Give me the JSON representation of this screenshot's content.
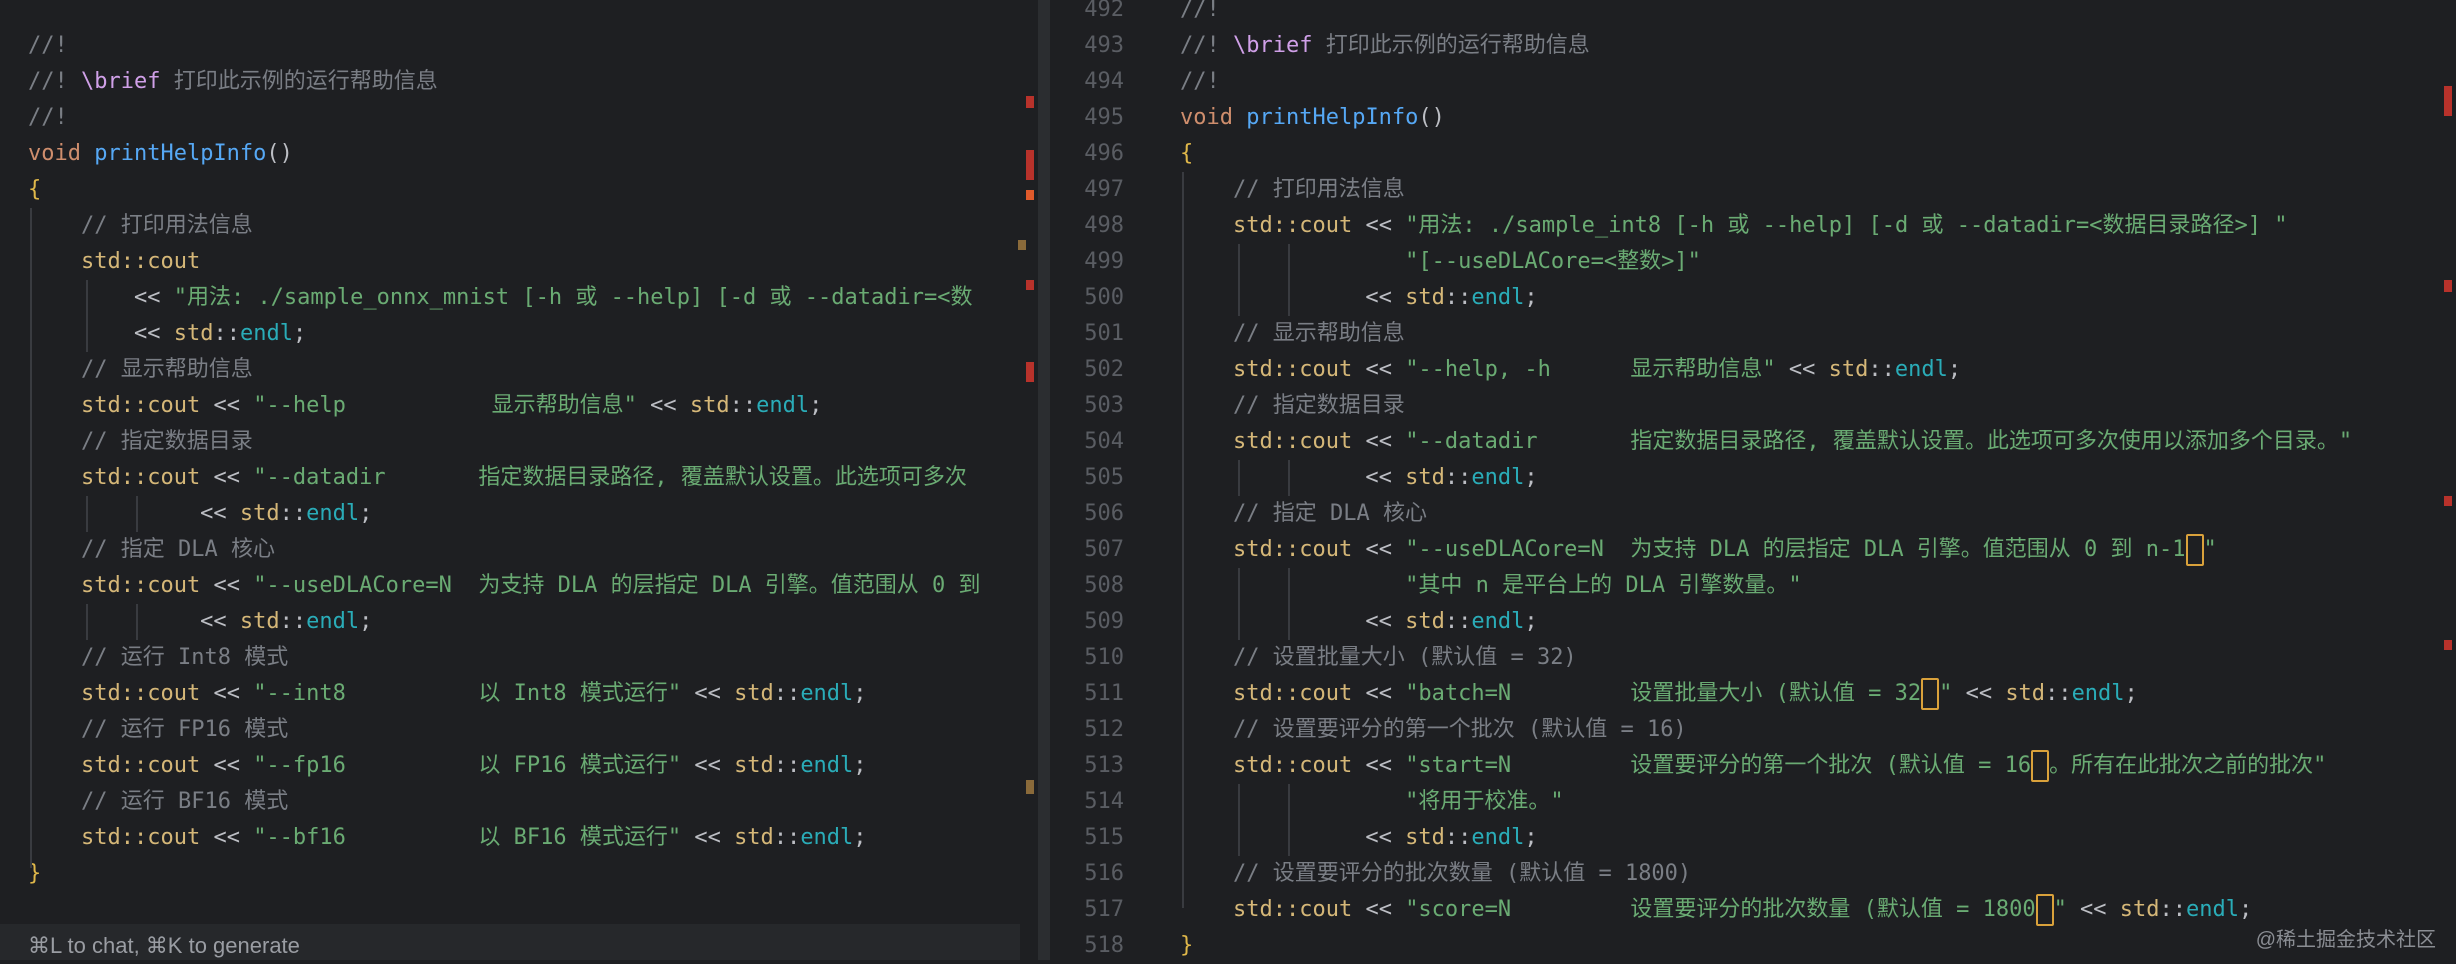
{
  "left": {
    "lines": [
      {
        "tokens": [
          [
            "c-comment",
            "//!"
          ]
        ]
      },
      {
        "tokens": [
          [
            "c-comment",
            "//! "
          ],
          [
            "c-doxy",
            "\\brief"
          ],
          [
            "c-comment",
            " 打印此示例的运行帮助信息"
          ]
        ]
      },
      {
        "tokens": [
          [
            "c-comment",
            "//!"
          ]
        ]
      },
      {
        "tokens": [
          [
            "c-keyword",
            "void"
          ],
          [
            "c-op",
            " "
          ],
          [
            "c-func",
            "printHelpInfo"
          ],
          [
            "c-op",
            "()"
          ]
        ]
      },
      {
        "tokens": [
          [
            "c-brace",
            "{"
          ]
        ]
      },
      {
        "tokens": [
          [
            "c-op",
            "    "
          ],
          [
            "c-comment",
            "// 打印用法信息"
          ]
        ]
      },
      {
        "tokens": [
          [
            "c-op",
            "    "
          ],
          [
            "c-ident",
            "std::cout"
          ]
        ]
      },
      {
        "tokens": [
          [
            "c-op",
            "        << "
          ],
          [
            "c-string",
            "\"用法: ./sample_onnx_mnist [-h 或 --help] [-d 或 --datadir=<数"
          ]
        ]
      },
      {
        "tokens": [
          [
            "c-op",
            "        << "
          ],
          [
            "c-ident",
            "std"
          ],
          [
            "c-colon",
            "::"
          ],
          [
            "c-endl",
            "endl"
          ],
          [
            "c-op",
            ";"
          ]
        ]
      },
      {
        "tokens": [
          [
            "c-op",
            "    "
          ],
          [
            "c-comment",
            "// 显示帮助信息"
          ]
        ]
      },
      {
        "tokens": [
          [
            "c-op",
            "    "
          ],
          [
            "c-ident",
            "std::cout"
          ],
          [
            "c-op",
            " << "
          ],
          [
            "c-string",
            "\"--help           显示帮助信息\""
          ],
          [
            "c-op",
            " << "
          ],
          [
            "c-ident",
            "std"
          ],
          [
            "c-colon",
            "::"
          ],
          [
            "c-endl",
            "endl"
          ],
          [
            "c-op",
            ";"
          ]
        ]
      },
      {
        "tokens": [
          [
            "c-op",
            "    "
          ],
          [
            "c-comment",
            "// 指定数据目录"
          ]
        ]
      },
      {
        "tokens": [
          [
            "c-op",
            "    "
          ],
          [
            "c-ident",
            "std::cout"
          ],
          [
            "c-op",
            " << "
          ],
          [
            "c-string",
            "\"--datadir       指定数据目录路径, 覆盖默认设置。此选项可多次"
          ]
        ]
      },
      {
        "tokens": [
          [
            "c-op",
            "             << "
          ],
          [
            "c-ident",
            "std"
          ],
          [
            "c-colon",
            "::"
          ],
          [
            "c-endl",
            "endl"
          ],
          [
            "c-op",
            ";"
          ]
        ]
      },
      {
        "tokens": [
          [
            "c-op",
            "    "
          ],
          [
            "c-comment",
            "// 指定 DLA 核心"
          ]
        ]
      },
      {
        "tokens": [
          [
            "c-op",
            "    "
          ],
          [
            "c-ident",
            "std::cout"
          ],
          [
            "c-op",
            " << "
          ],
          [
            "c-string",
            "\"--useDLACore=N  为支持 DLA 的层指定 DLA 引擎。值范围从 0 到"
          ]
        ]
      },
      {
        "tokens": [
          [
            "c-op",
            "             << "
          ],
          [
            "c-ident",
            "std"
          ],
          [
            "c-colon",
            "::"
          ],
          [
            "c-endl",
            "endl"
          ],
          [
            "c-op",
            ";"
          ]
        ]
      },
      {
        "tokens": [
          [
            "c-op",
            "    "
          ],
          [
            "c-comment",
            "// 运行 Int8 模式"
          ]
        ]
      },
      {
        "tokens": [
          [
            "c-op",
            "    "
          ],
          [
            "c-ident",
            "std::cout"
          ],
          [
            "c-op",
            " << "
          ],
          [
            "c-string",
            "\"--int8          以 Int8 模式运行\""
          ],
          [
            "c-op",
            " << "
          ],
          [
            "c-ident",
            "std"
          ],
          [
            "c-colon",
            "::"
          ],
          [
            "c-endl",
            "endl"
          ],
          [
            "c-op",
            ";"
          ]
        ]
      },
      {
        "tokens": [
          [
            "c-op",
            "    "
          ],
          [
            "c-comment",
            "// 运行 FP16 模式"
          ]
        ]
      },
      {
        "tokens": [
          [
            "c-op",
            "    "
          ],
          [
            "c-ident",
            "std::cout"
          ],
          [
            "c-op",
            " << "
          ],
          [
            "c-string",
            "\"--fp16          以 FP16 模式运行\""
          ],
          [
            "c-op",
            " << "
          ],
          [
            "c-ident",
            "std"
          ],
          [
            "c-colon",
            "::"
          ],
          [
            "c-endl",
            "endl"
          ],
          [
            "c-op",
            ";"
          ]
        ]
      },
      {
        "tokens": [
          [
            "c-op",
            "    "
          ],
          [
            "c-comment",
            "// 运行 BF16 模式"
          ]
        ]
      },
      {
        "tokens": [
          [
            "c-op",
            "    "
          ],
          [
            "c-ident",
            "std::cout"
          ],
          [
            "c-op",
            " << "
          ],
          [
            "c-string",
            "\"--bf16          以 BF16 模式运行\""
          ],
          [
            "c-op",
            " << "
          ],
          [
            "c-ident",
            "std"
          ],
          [
            "c-colon",
            "::"
          ],
          [
            "c-endl",
            "endl"
          ],
          [
            "c-op",
            ";"
          ]
        ]
      },
      {
        "tokens": [
          [
            "c-brace",
            "}"
          ]
        ]
      }
    ],
    "chat_hint": "⌘L to chat, ⌘K to generate"
  },
  "right": {
    "lines": [
      {
        "num": "492",
        "tokens": [
          [
            "c-comment",
            "//!"
          ]
        ]
      },
      {
        "num": "493",
        "tokens": [
          [
            "c-comment",
            "//! "
          ],
          [
            "c-doxy",
            "\\brief"
          ],
          [
            "c-comment",
            " 打印此示例的运行帮助信息"
          ]
        ]
      },
      {
        "num": "494",
        "tokens": [
          [
            "c-comment",
            "//!"
          ]
        ]
      },
      {
        "num": "495",
        "tokens": [
          [
            "c-keyword",
            "void"
          ],
          [
            "c-op",
            " "
          ],
          [
            "c-func",
            "printHelpInfo"
          ],
          [
            "c-op",
            "()"
          ]
        ]
      },
      {
        "num": "496",
        "tokens": [
          [
            "c-brace",
            "{"
          ]
        ]
      },
      {
        "num": "497",
        "tokens": [
          [
            "c-op",
            "    "
          ],
          [
            "c-comment",
            "// 打印用法信息"
          ]
        ]
      },
      {
        "num": "498",
        "tokens": [
          [
            "c-op",
            "    "
          ],
          [
            "c-ident",
            "std::cout"
          ],
          [
            "c-op",
            " << "
          ],
          [
            "c-string",
            "\"用法: ./sample_int8 [-h 或 --help] [-d 或 --datadir=<数据目录路径>] \""
          ]
        ]
      },
      {
        "num": "499",
        "tokens": [
          [
            "c-op",
            "                 "
          ],
          [
            "c-string",
            "\"[--useDLACore=<整数>]\""
          ]
        ]
      },
      {
        "num": "500",
        "tokens": [
          [
            "c-op",
            "              << "
          ],
          [
            "c-ident",
            "std"
          ],
          [
            "c-colon",
            "::"
          ],
          [
            "c-endl",
            "endl"
          ],
          [
            "c-op",
            ";"
          ]
        ]
      },
      {
        "num": "501",
        "tokens": [
          [
            "c-op",
            "    "
          ],
          [
            "c-comment",
            "// 显示帮助信息"
          ]
        ]
      },
      {
        "num": "502",
        "tokens": [
          [
            "c-op",
            "    "
          ],
          [
            "c-ident",
            "std::cout"
          ],
          [
            "c-op",
            " << "
          ],
          [
            "c-string",
            "\"--help, -h      显示帮助信息\""
          ],
          [
            "c-op",
            " << "
          ],
          [
            "c-ident",
            "std"
          ],
          [
            "c-colon",
            "::"
          ],
          [
            "c-endl",
            "endl"
          ],
          [
            "c-op",
            ";"
          ]
        ]
      },
      {
        "num": "503",
        "tokens": [
          [
            "c-op",
            "    "
          ],
          [
            "c-comment",
            "// 指定数据目录"
          ]
        ]
      },
      {
        "num": "504",
        "tokens": [
          [
            "c-op",
            "    "
          ],
          [
            "c-ident",
            "std::cout"
          ],
          [
            "c-op",
            " << "
          ],
          [
            "c-string",
            "\"--datadir       指定数据目录路径, 覆盖默认设置。此选项可多次使用以添加多个目录。\""
          ]
        ]
      },
      {
        "num": "505",
        "tokens": [
          [
            "c-op",
            "              << "
          ],
          [
            "c-ident",
            "std"
          ],
          [
            "c-colon",
            "::"
          ],
          [
            "c-endl",
            "endl"
          ],
          [
            "c-op",
            ";"
          ]
        ]
      },
      {
        "num": "506",
        "tokens": [
          [
            "c-op",
            "    "
          ],
          [
            "c-comment",
            "// 指定 DLA 核心"
          ]
        ]
      },
      {
        "num": "507",
        "tokens": [
          [
            "c-op",
            "    "
          ],
          [
            "c-ident",
            "std::cout"
          ],
          [
            "c-op",
            " << "
          ],
          [
            "c-string",
            "\"--useDLACore=N  为支持 DLA 的层指定 DLA 引擎。值范围从 0 到 n-1"
          ],
          [
            "cursor",
            ""
          ],
          [
            "c-string",
            "\""
          ]
        ]
      },
      {
        "num": "508",
        "tokens": [
          [
            "c-op",
            "                 "
          ],
          [
            "c-string",
            "\"其中 n 是平台上的 DLA 引擎数量。\""
          ]
        ]
      },
      {
        "num": "509",
        "tokens": [
          [
            "c-op",
            "              << "
          ],
          [
            "c-ident",
            "std"
          ],
          [
            "c-colon",
            "::"
          ],
          [
            "c-endl",
            "endl"
          ],
          [
            "c-op",
            ";"
          ]
        ]
      },
      {
        "num": "510",
        "tokens": [
          [
            "c-op",
            "    "
          ],
          [
            "c-comment",
            "// 设置批量大小 (默认值 = 32)"
          ]
        ]
      },
      {
        "num": "511",
        "tokens": [
          [
            "c-op",
            "    "
          ],
          [
            "c-ident",
            "std::cout"
          ],
          [
            "c-op",
            " << "
          ],
          [
            "c-string",
            "\"batch=N         设置批量大小 (默认值 = 32"
          ],
          [
            "cursor",
            ""
          ],
          [
            "c-string",
            "\""
          ],
          [
            "c-op",
            " << "
          ],
          [
            "c-ident",
            "std"
          ],
          [
            "c-colon",
            "::"
          ],
          [
            "c-endl",
            "endl"
          ],
          [
            "c-op",
            ";"
          ]
        ]
      },
      {
        "num": "512",
        "tokens": [
          [
            "c-op",
            "    "
          ],
          [
            "c-comment",
            "// 设置要评分的第一个批次 (默认值 = 16)"
          ]
        ]
      },
      {
        "num": "513",
        "tokens": [
          [
            "c-op",
            "    "
          ],
          [
            "c-ident",
            "std::cout"
          ],
          [
            "c-op",
            " << "
          ],
          [
            "c-string",
            "\"start=N         设置要评分的第一个批次 (默认值 = 16"
          ],
          [
            "cursor",
            ""
          ],
          [
            "c-string",
            "。所有在此批次之前的批次\""
          ]
        ]
      },
      {
        "num": "514",
        "tokens": [
          [
            "c-op",
            "                 "
          ],
          [
            "c-string",
            "\"将用于校准。\""
          ]
        ]
      },
      {
        "num": "515",
        "tokens": [
          [
            "c-op",
            "              << "
          ],
          [
            "c-ident",
            "std"
          ],
          [
            "c-colon",
            "::"
          ],
          [
            "c-endl",
            "endl"
          ],
          [
            "c-op",
            ";"
          ]
        ]
      },
      {
        "num": "516",
        "tokens": [
          [
            "c-op",
            "    "
          ],
          [
            "c-comment",
            "// 设置要评分的批次数量 (默认值 = 1800)"
          ]
        ]
      },
      {
        "num": "517",
        "tokens": [
          [
            "c-op",
            "    "
          ],
          [
            "c-ident",
            "std::cout"
          ],
          [
            "c-op",
            " << "
          ],
          [
            "c-string",
            "\"score=N         设置要评分的批次数量 (默认值 = 1800"
          ],
          [
            "cursor",
            ""
          ],
          [
            "c-string",
            "\""
          ],
          [
            "c-op",
            " << "
          ],
          [
            "c-ident",
            "std"
          ],
          [
            "c-colon",
            "::"
          ],
          [
            "c-endl",
            "endl"
          ],
          [
            "c-op",
            ";"
          ]
        ]
      },
      {
        "num": "518",
        "tokens": [
          [
            "c-brace",
            "}"
          ]
        ]
      }
    ]
  },
  "watermark": "@稀土掘金技术社区",
  "colors": {
    "background": "#1e1f22",
    "comment": "#7a7e85",
    "keyword": "#cf8e6d",
    "function": "#56a8f5",
    "string": "#6aab73",
    "identifier": "#d5b778",
    "endl": "#2aacb8",
    "brace": "#e0b84a",
    "cursor": "#d9a13b"
  }
}
